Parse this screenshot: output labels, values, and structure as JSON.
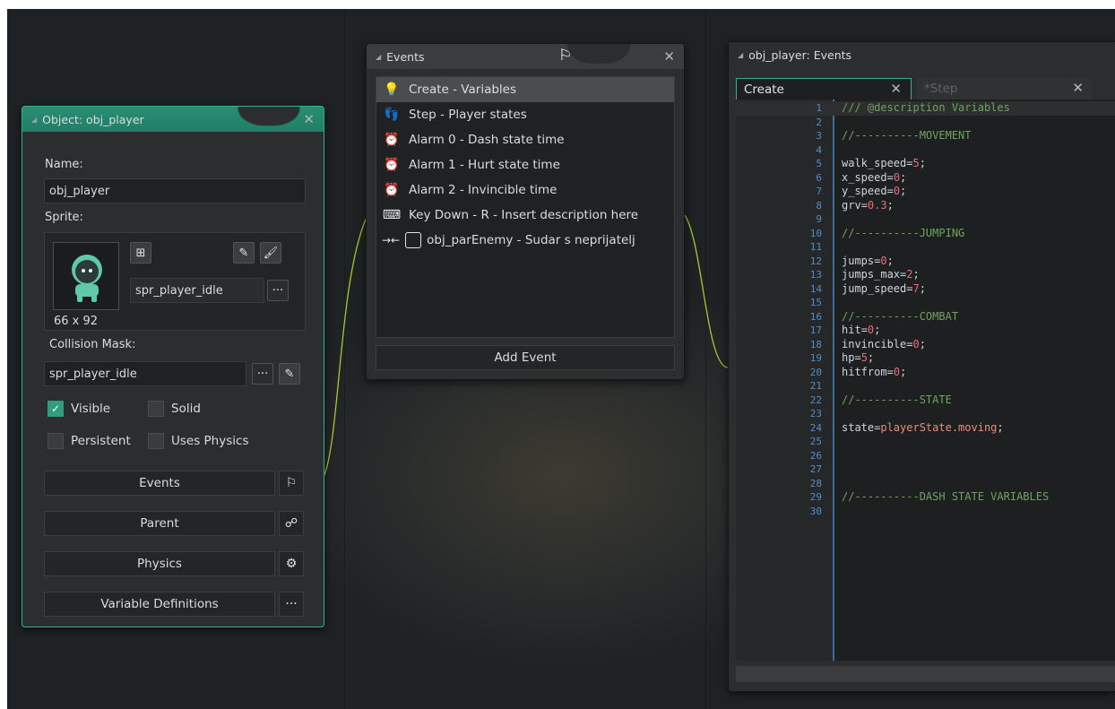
{
  "object_window": {
    "title": "Object: obj_player",
    "name_label": "Name:",
    "name_value": "obj_player",
    "sprite_label": "Sprite:",
    "sprite_name": "spr_player_idle",
    "sprite_size": "66 x 92",
    "collision_label": "Collision Mask:",
    "collision_value": "spr_player_idle",
    "visible_label": "Visible",
    "visible_checked": true,
    "solid_label": "Solid",
    "persistent_label": "Persistent",
    "physics_checkbox_label": "Uses Physics",
    "events_button": "Events",
    "parent_button": "Parent",
    "physics_button": "Physics",
    "vardefs_button": "Variable Definitions",
    "ellipsis": "···"
  },
  "events_window": {
    "title": "Events",
    "items": [
      {
        "label": "Create - Variables",
        "icon": "lightbulb-icon"
      },
      {
        "label": "Step - Player states",
        "icon": "footsteps-icon"
      },
      {
        "label": "Alarm 0 - Dash state time",
        "icon": "alarm-clock-icon"
      },
      {
        "label": "Alarm 1 - Hurt state time",
        "icon": "alarm-clock-icon"
      },
      {
        "label": "Alarm 2 - Invincible time",
        "icon": "alarm-clock-icon"
      },
      {
        "label": "Key Down - R - Insert description here",
        "icon": "keyboard-icon"
      },
      {
        "label": "obj_parEnemy - Sudar s neprijatelj",
        "icon": "collision-icon"
      }
    ],
    "add_event": "Add Event"
  },
  "code_window": {
    "title": "obj_player: Events",
    "tabs": [
      {
        "label": "Create",
        "active": true
      },
      {
        "label": "*Step",
        "active": false
      }
    ],
    "lines": [
      {
        "n": "1",
        "text": "/// @description Variables"
      },
      {
        "n": "2",
        "text": ""
      },
      {
        "n": "3",
        "text": "//----------MOVEMENT"
      },
      {
        "n": "4",
        "text": ""
      },
      {
        "n": "5",
        "text": "walk_speed=5;"
      },
      {
        "n": "6",
        "text": "x_speed=0;"
      },
      {
        "n": "7",
        "text": "y_speed=0;"
      },
      {
        "n": "8",
        "text": "grv=0.3;"
      },
      {
        "n": "9",
        "text": ""
      },
      {
        "n": "10",
        "text": "//----------JUMPING"
      },
      {
        "n": "11",
        "text": ""
      },
      {
        "n": "12",
        "text": "jumps=0;"
      },
      {
        "n": "13",
        "text": "jumps_max=2;"
      },
      {
        "n": "14",
        "text": "jump_speed=7;"
      },
      {
        "n": "15",
        "text": ""
      },
      {
        "n": "16",
        "text": "//----------COMBAT"
      },
      {
        "n": "17",
        "text": "hit=0;"
      },
      {
        "n": "18",
        "text": "invincible=0;"
      },
      {
        "n": "19",
        "text": "hp=5;"
      },
      {
        "n": "20",
        "text": "hitfrom=0;"
      },
      {
        "n": "21",
        "text": ""
      },
      {
        "n": "22",
        "text": "//----------STATE"
      },
      {
        "n": "23",
        "text": ""
      },
      {
        "n": "24",
        "text": "state=playerState.moving;"
      },
      {
        "n": "25",
        "text": ""
      },
      {
        "n": "26",
        "text": ""
      },
      {
        "n": "27",
        "text": ""
      },
      {
        "n": "28",
        "text": ""
      },
      {
        "n": "29",
        "text": "//----------DASH STATE VARIABLES"
      },
      {
        "n": "30",
        "text": ""
      }
    ]
  },
  "colors": {
    "accent": "#34b08a",
    "comment": "#6fa35e",
    "number": "#f0697a",
    "line_number": "#4f8fc9",
    "wire": "#a6c832"
  }
}
